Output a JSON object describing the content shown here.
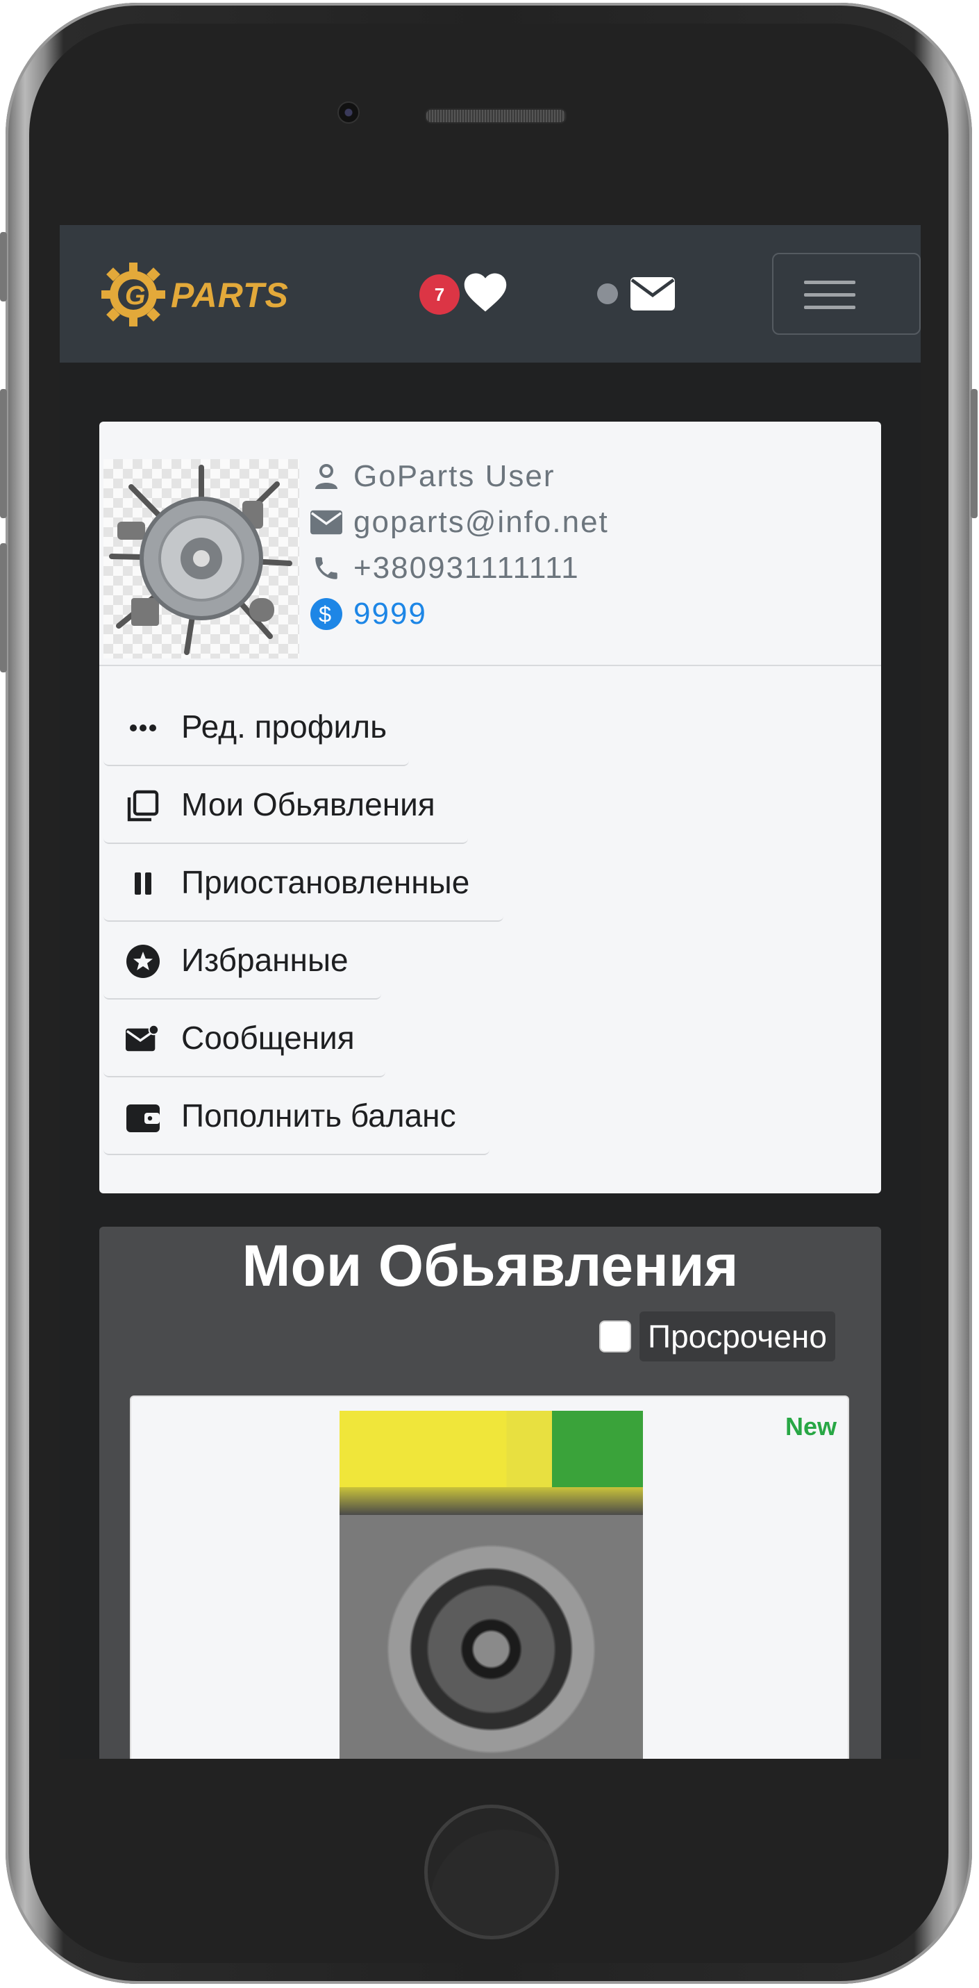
{
  "navbar": {
    "logo_text": "PARTS",
    "favorites_count": "7"
  },
  "profile": {
    "name": "GoParts User",
    "email": "goparts@info.net",
    "phone": "+380931111111",
    "balance": "9999"
  },
  "menu": {
    "items": [
      {
        "label": "Ред. профиль",
        "icon": "dots-icon"
      },
      {
        "label": "Мои Обьявления",
        "icon": "collection-icon"
      },
      {
        "label": "Приостановленные",
        "icon": "pause-icon"
      },
      {
        "label": "Избранные",
        "icon": "star-circle-icon"
      },
      {
        "label": "Сообщения",
        "icon": "envelope-dot-icon"
      },
      {
        "label": "Пополнить баланс",
        "icon": "wallet-icon"
      }
    ]
  },
  "listings": {
    "title": "Мои Обьявления",
    "expired_label": "Просрочено",
    "ad": {
      "condition": "New"
    }
  },
  "colors": {
    "navbar_bg": "#343a40",
    "badge": "#dc3545",
    "balance": "#1d86e6",
    "new": "#28a745",
    "logo": "#e3a93a"
  }
}
